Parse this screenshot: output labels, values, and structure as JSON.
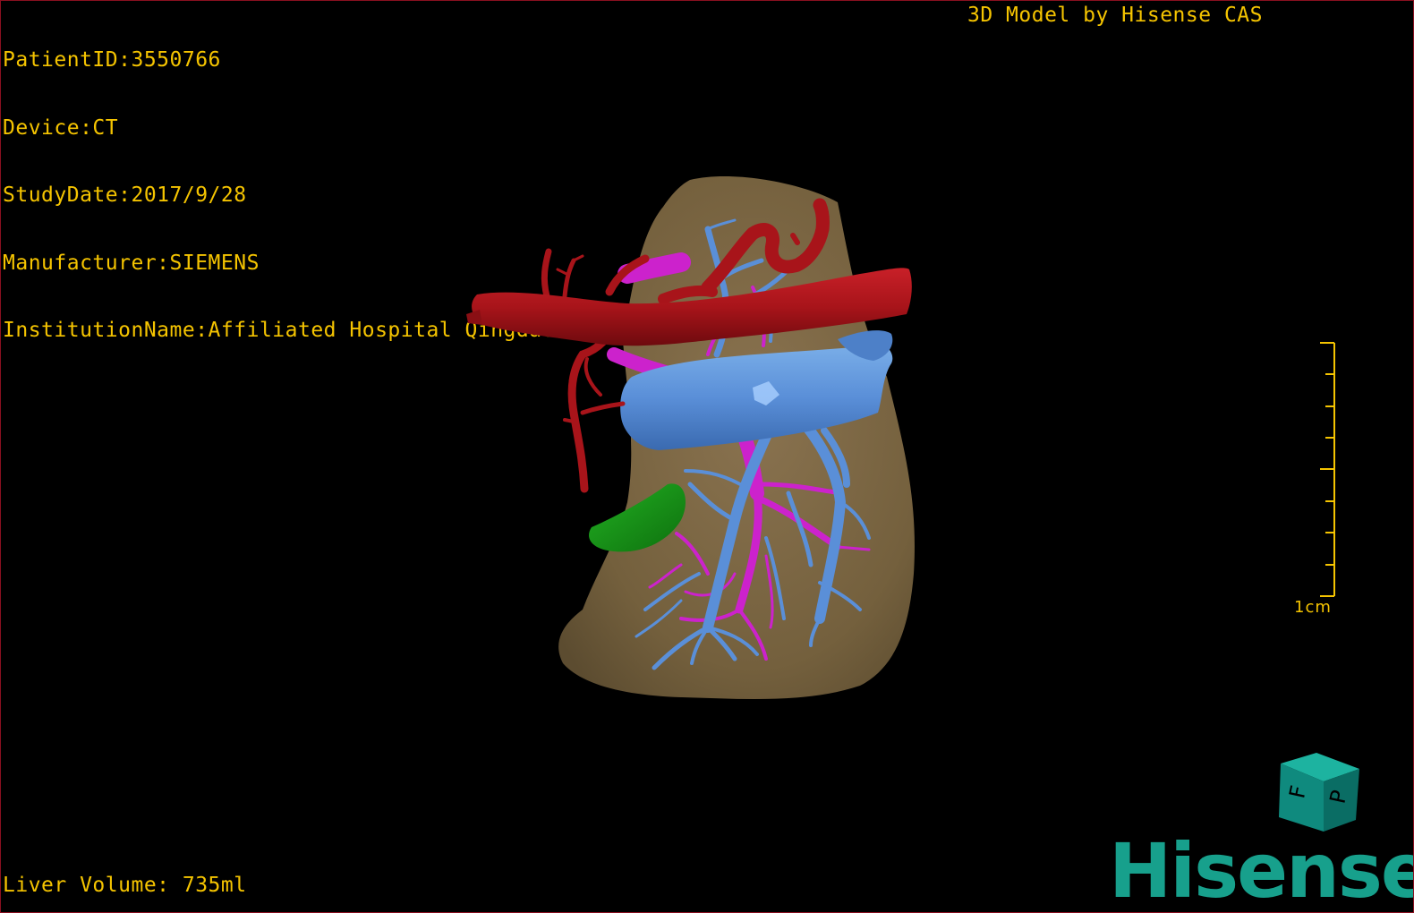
{
  "header": {
    "patient_id": "PatientID:3550766",
    "device": "Device:CT",
    "study_date": "StudyDate:2017/9/28",
    "manufacturer": "Manufacturer:SIEMENS",
    "institution": "InstitutionName:Affiliated Hospital Qingdao University-C"
  },
  "credit": "3D Model by Hisense CAS",
  "footer": {
    "liver_volume": "Liver Volume: 735ml"
  },
  "scale_bar": {
    "label": "1cm",
    "color": "#f5c400"
  },
  "orientation_cube": {
    "face_front": "F",
    "face_side": "P",
    "color": "#0f8a7e"
  },
  "brand": {
    "logo_text": "Hisense",
    "color": "#17a08c"
  },
  "model_colors": {
    "liver": "#7a6440",
    "artery": "#a8141a",
    "portal_vein": "#cc22cc",
    "hepatic_vein": "#5a8fd8",
    "gallbladder": "#1a9a1a"
  },
  "text_color": "#f5c400",
  "border_color": "#8a1020"
}
